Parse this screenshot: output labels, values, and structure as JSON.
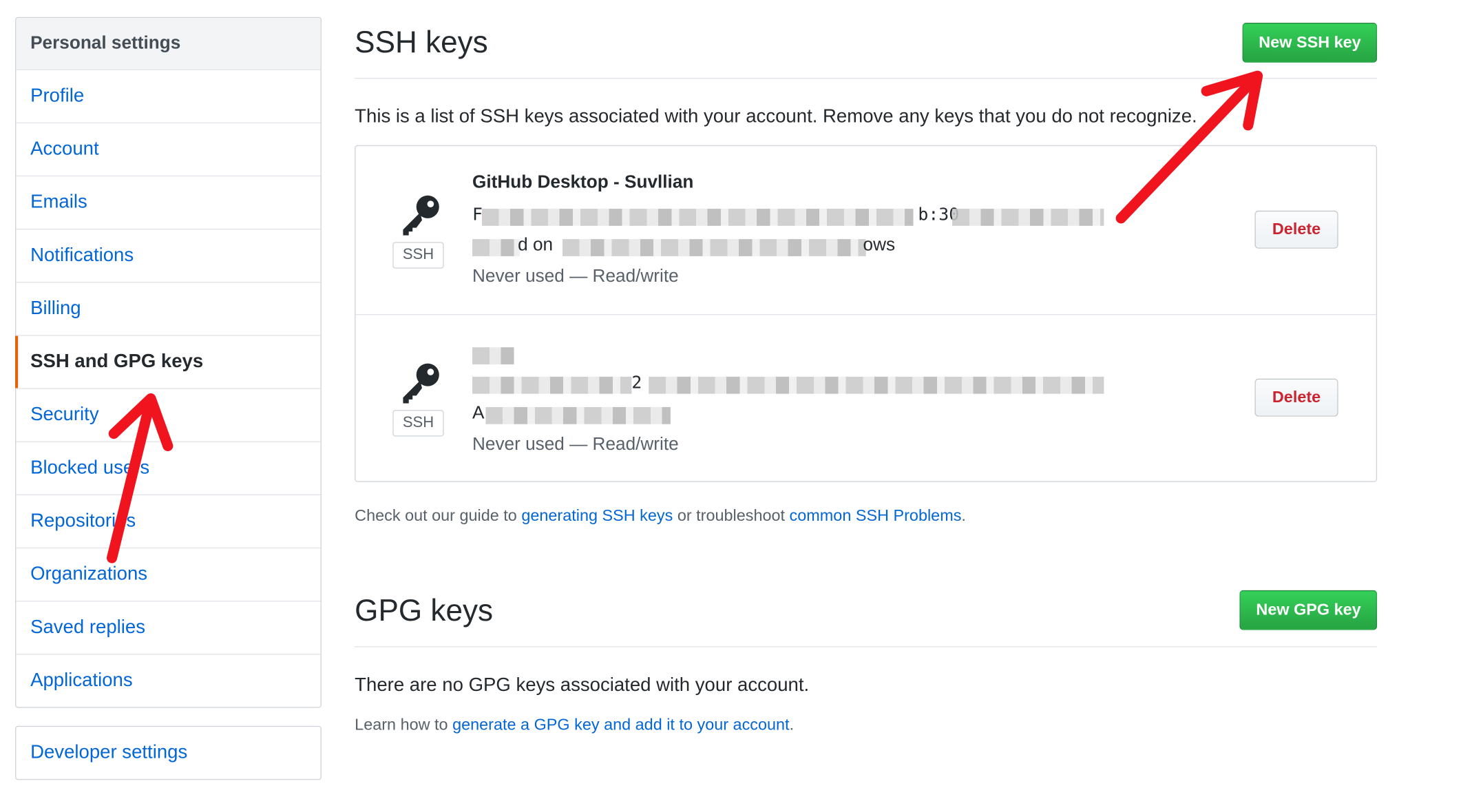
{
  "sidebar": {
    "heading": "Personal settings",
    "items": [
      {
        "label": "Profile"
      },
      {
        "label": "Account"
      },
      {
        "label": "Emails"
      },
      {
        "label": "Notifications"
      },
      {
        "label": "Billing"
      },
      {
        "label": "SSH and GPG keys",
        "selected": true
      },
      {
        "label": "Security"
      },
      {
        "label": "Blocked users"
      },
      {
        "label": "Repositories"
      },
      {
        "label": "Organizations"
      },
      {
        "label": "Saved replies"
      },
      {
        "label": "Applications"
      }
    ],
    "developer_settings": "Developer settings"
  },
  "ssh": {
    "title": "SSH keys",
    "new_button": "New SSH key",
    "description": "This is a list of SSH keys associated with your account. Remove any keys that you do not recognize.",
    "keys": [
      {
        "title": "GitHub Desktop - Suvllian",
        "fingerprint_visible": "b:30",
        "added_visible": "d on",
        "added_tail": "ows",
        "usage": "Never used — Read/write",
        "badge": "SSH",
        "delete_label": "Delete"
      },
      {
        "title": "",
        "fingerprint_visible": "2",
        "added_visible": "A",
        "added_tail": "",
        "usage": "Never used — Read/write",
        "badge": "SSH",
        "delete_label": "Delete"
      }
    ],
    "guide": {
      "prefix": "Check out our guide to ",
      "link1": "generating SSH keys",
      "middle": " or troubleshoot ",
      "link2": "common SSH Problems",
      "suffix": "."
    }
  },
  "gpg": {
    "title": "GPG keys",
    "new_button": "New GPG key",
    "empty": "There are no GPG keys associated with your account.",
    "learn": {
      "prefix": "Learn how to ",
      "link": "generate a GPG key and add it to your account",
      "suffix": "."
    }
  },
  "colors": {
    "link": "#0366d6",
    "primary_button": "#28a745",
    "danger": "#cb2431",
    "selected_marker": "#e36209",
    "annotation_arrow": "#f0141e"
  },
  "icons": [
    "key-icon",
    "annotation-arrow"
  ]
}
